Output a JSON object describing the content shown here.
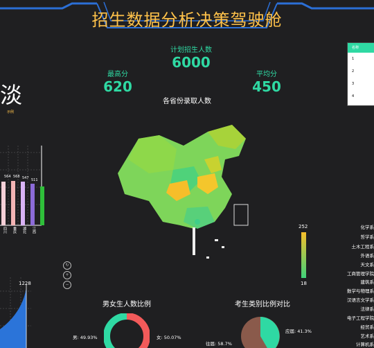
{
  "header": {
    "title": "招生数据分析决策驾驶舱"
  },
  "stats": {
    "plan": {
      "label": "计划招生人数",
      "value": "6000"
    },
    "max": {
      "label": "最高分",
      "value": "620"
    },
    "avg": {
      "label": "平均分",
      "value": "450"
    }
  },
  "map": {
    "title": "各省份录取人数",
    "legend_max": "252",
    "legend_min": "18"
  },
  "left_panel": {
    "big_char": "淡",
    "caption": "示例",
    "bar_values": [
      "564",
      "568",
      "547",
      "511"
    ],
    "bar_labels": [
      "四川",
      "重庆",
      "湖北",
      "江西"
    ],
    "area_peak_label": "1228"
  },
  "table": {
    "rows": [
      "1",
      "2",
      "3",
      "4"
    ],
    "header": "名称"
  },
  "departments": [
    "化学系",
    "哲学系",
    "土木工程系",
    "外语系",
    "天文系",
    "工商管理学院",
    "建筑系",
    "数学与物理系",
    "汉语言文学系",
    "法律系",
    "电子工程学院",
    "经贸系",
    "艺术系",
    "计算机系"
  ],
  "gender_chart": {
    "title": "男女生人数比例",
    "male_label": "男: 49.93%",
    "female_label": "女: 50.07%",
    "male_pct": 49.93,
    "female_pct": 50.07,
    "male_color": "#2fd9a3",
    "female_color": "#f25a5a"
  },
  "category_chart": {
    "title": "考生类别比例对比",
    "a_label": "应届: 41.3%",
    "b_label": "往届: 58.7%",
    "a_pct": 41.3,
    "b_pct": 58.7,
    "a_color": "#2fd9a3",
    "b_color": "#8a5a4b"
  },
  "colors": {
    "accent": "#2fd9a3",
    "title": "#ffc24a",
    "frame": "#2b6fd6"
  }
}
